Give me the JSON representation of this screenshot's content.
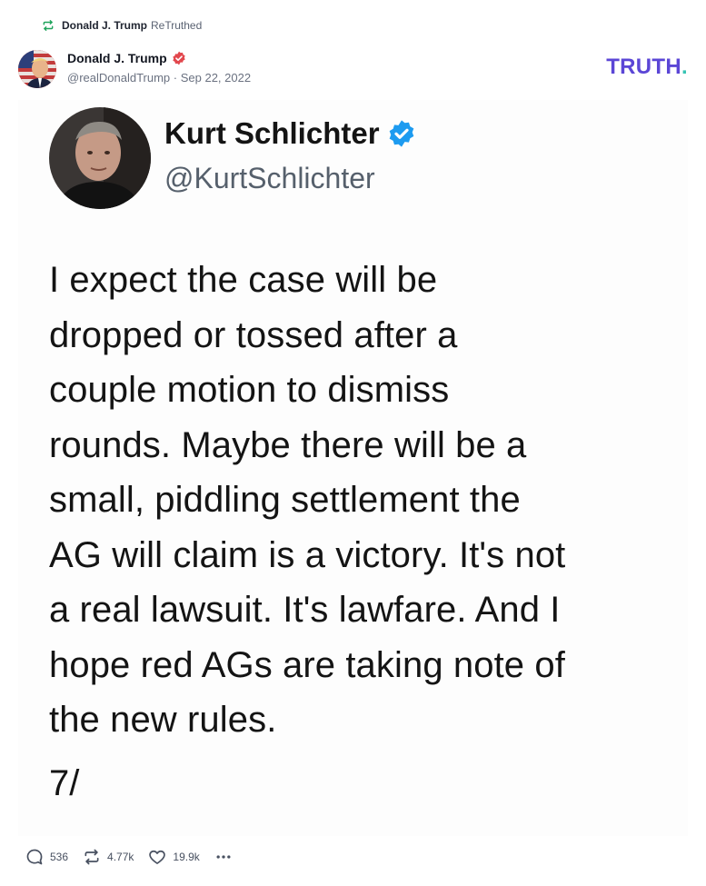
{
  "retruth": {
    "name": "Donald J. Trump",
    "action": "ReTruthed",
    "icon": "retruth-icon"
  },
  "post": {
    "author_name": "Donald J. Trump",
    "verified_icon": "verified-badge-icon",
    "handle": "@realDonaldTrump",
    "separator": " · ",
    "date": "Sep 22, 2022"
  },
  "brand": {
    "logo_text": "TRUTH",
    "logo_dot": ".",
    "color": "#5b46d6",
    "dot_color": "#36c4b4"
  },
  "embed": {
    "name": "Kurt Schlichter",
    "handle": "@KurtSchlichter",
    "verified_color": "#1d9bf0",
    "lines": [
      "I expect the case will be",
      "dropped or tossed after a",
      "couple motion to dismiss",
      "rounds. Maybe there will be a",
      "small, piddling settlement the",
      "AG will claim is a victory. It's not",
      "a real lawsuit. It's lawfare. And I",
      "hope red AGs are taking note of",
      "the new rules."
    ],
    "counter": "7/"
  },
  "actions": {
    "replies": "536",
    "retruths": "4.77k",
    "likes": "19.9k",
    "more_icon": "more-icon"
  }
}
